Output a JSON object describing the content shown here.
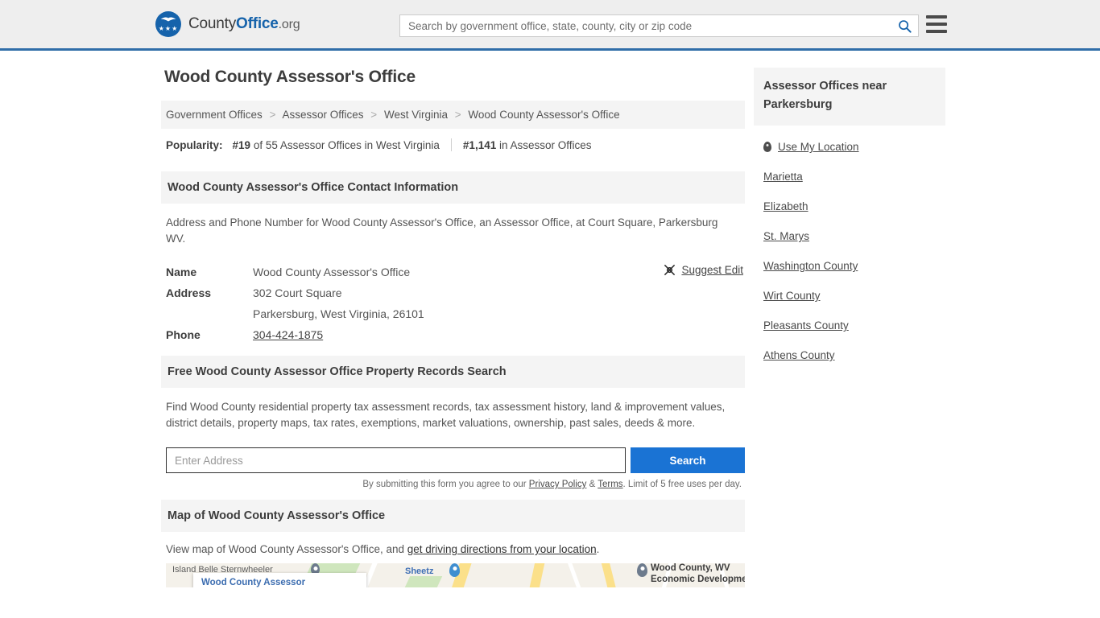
{
  "header": {
    "logo_name": "CountyOffice",
    "logo_prefix": "County",
    "logo_highlight": "Office",
    "logo_suffix": ".org",
    "search_placeholder": "Search by government office, state, county, city or zip code",
    "search_value": "",
    "search_icon": "search-icon",
    "menu_icon": "hamburger-menu-icon",
    "accent_color": "#1663ab",
    "border_color": "#2f6da8"
  },
  "page": {
    "title": "Wood County Assessor's Office"
  },
  "breadcrumb": {
    "items": [
      {
        "label": "Government Offices"
      },
      {
        "label": "Assessor Offices"
      },
      {
        "label": "West Virginia"
      },
      {
        "label": "Wood County Assessor's Office"
      }
    ],
    "separator": ">"
  },
  "popularity": {
    "label": "Popularity:",
    "rank_state": "#19",
    "rank_state_text": "of 55 Assessor Offices in West Virginia",
    "rank_overall": "#1,141",
    "rank_overall_text": "in Assessor Offices"
  },
  "contact": {
    "section_title": "Wood County Assessor's Office Contact Information",
    "description": "Address and Phone Number for Wood County Assessor's Office, an Assessor Office, at Court Square, Parkersburg WV.",
    "suggest_edit_label": "Suggest Edit",
    "suggest_edit_icon": "edit-icon",
    "rows": [
      {
        "label": "Name",
        "value": "Wood County Assessor's Office"
      },
      {
        "label": "Address",
        "value": "302 Court Square"
      },
      {
        "label": "",
        "value": "Parkersburg, West Virginia, 26101"
      },
      {
        "label": "Phone",
        "value": "304-424-1875",
        "link": true
      }
    ]
  },
  "property_search": {
    "section_title": "Free Wood County Assessor Office Property Records Search",
    "description": "Find Wood County residential property tax assessment records, tax assessment history, land & improvement values, district details, property maps, tax rates, exemptions, market valuations, ownership, past sales, deeds & more.",
    "input_placeholder": "Enter Address",
    "input_value": "",
    "button_label": "Search",
    "button_color": "#1a73d4",
    "note_prefix": "By submitting this form you agree to our ",
    "note_privacy": "Privacy Policy",
    "note_amp": " & ",
    "note_terms": "Terms",
    "note_suffix": ". Limit of 5 free uses per day."
  },
  "map": {
    "section_title": "Map of Wood County Assessor's Office",
    "description_prefix": "View map of Wood County Assessor's Office, and ",
    "description_link": "get driving directions from your location",
    "description_suffix": ".",
    "labels": [
      {
        "text": "Island Belle Sternwheeler",
        "kind": "poi"
      },
      {
        "text": "Sheetz",
        "kind": "brand"
      },
      {
        "text": "Wood County, WV",
        "kind": "place"
      },
      {
        "text": "Economic Development",
        "kind": "place"
      },
      {
        "text": "Wood County Assessor",
        "kind": "card"
      }
    ]
  },
  "sidebar": {
    "title": "Assessor Offices near Parkersburg",
    "items": [
      {
        "label": "Use My Location",
        "icon": "location-pin-icon"
      },
      {
        "label": "Marietta"
      },
      {
        "label": "Elizabeth"
      },
      {
        "label": "St. Marys"
      },
      {
        "label": "Washington County"
      },
      {
        "label": "Wirt County"
      },
      {
        "label": "Pleasants County"
      },
      {
        "label": "Athens County"
      }
    ]
  }
}
